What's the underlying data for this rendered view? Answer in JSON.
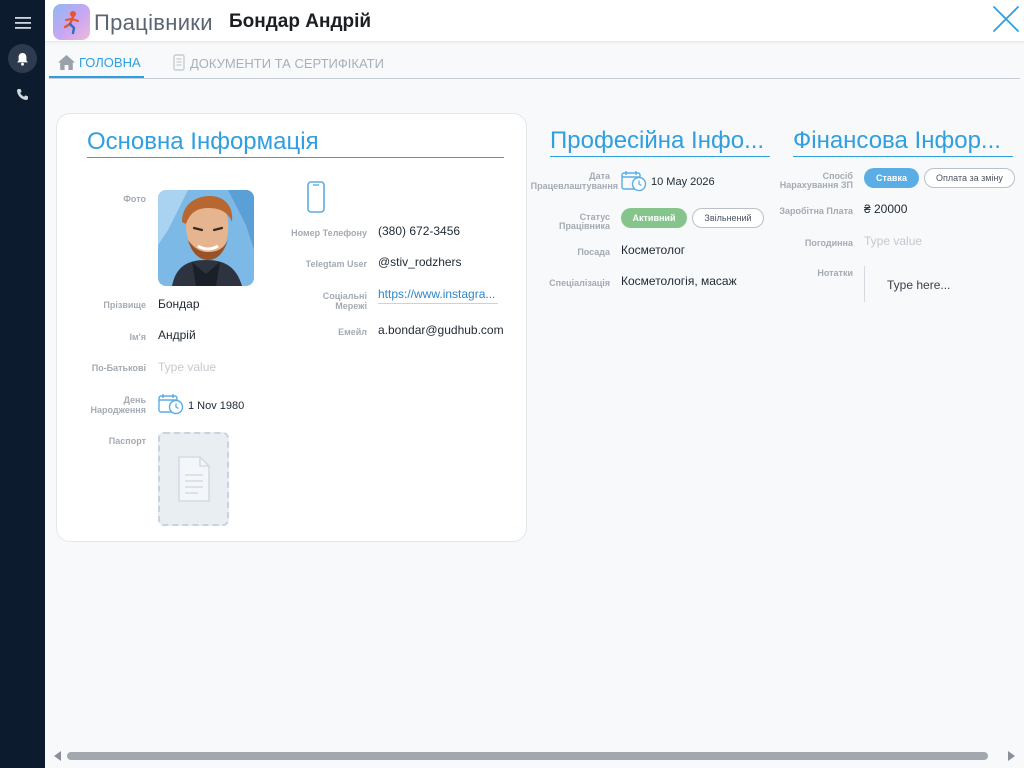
{
  "header": {
    "app_name": "Працівники",
    "record_name": "Бондар Андрій"
  },
  "tabs": [
    {
      "label": "ГОЛОВНА",
      "active": true
    },
    {
      "label": "ДОКУМЕНТИ ТА СЕРТИФІКАТИ",
      "active": false
    }
  ],
  "basic": {
    "title": "Основна Інформація",
    "photo_label": "Фото",
    "surname_label": "Прізвище",
    "surname": "Бондар",
    "name_label": "Ім'я",
    "name": "Андрій",
    "patronymic_label": "По-Батькові",
    "patronymic_placeholder": "Type value",
    "birthday_label_1": "День",
    "birthday_label_2": "Народження",
    "birthday": "1 Nov 1980",
    "passport_label": "Паспорт",
    "phone_label": "Номер Телефону",
    "phone": "(380) 672-3456",
    "telegram_label": "Telegtam User",
    "telegram": "@stiv_rodzhers",
    "social_label_1": "Соціальні",
    "social_label_2": "Мережі",
    "social": "https://www.instagra...",
    "email_label": "Емейл",
    "email": "a.bondar@gudhub.com"
  },
  "professional": {
    "title": "Професійна Інфо...",
    "hire_label_1": "Дата",
    "hire_label_2": "Працевлаштування",
    "hire_date": "10 May 2026",
    "status_label_1": "Статус",
    "status_label_2": "Працівника",
    "status_active": "Активний",
    "status_fired": "Звільнений",
    "position_label": "Посада",
    "position": "Косметолог",
    "specialization_label": "Спеціалізація",
    "specialization": "Косметологія, масаж"
  },
  "financial": {
    "title": "Фінансова Інфор...",
    "method_label_1": "Спосіб",
    "method_label_2": "Нарахування ЗП",
    "method_rate": "Ставка",
    "method_shift": "Оплата за зміну",
    "salary_label": "Заробітна Плата",
    "salary": "₴ 20000",
    "hourly_label": "Погодинна",
    "hourly_placeholder": "Type value",
    "notes_label": "Нотатки",
    "notes_placeholder": "Type here..."
  },
  "colors": {
    "accent": "#2f9fe0",
    "rail": "#0d1b2e",
    "active_green": "#85c58b",
    "selected_blue": "#5aaee5"
  }
}
